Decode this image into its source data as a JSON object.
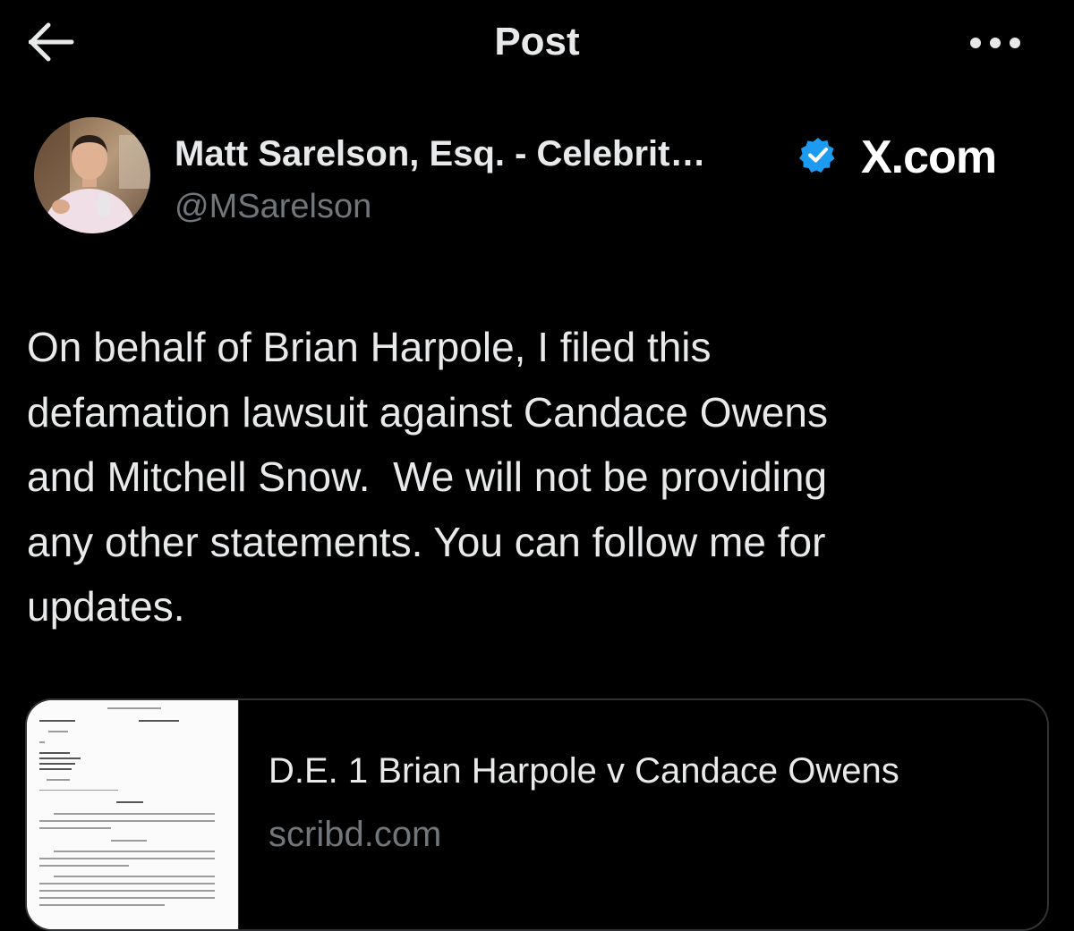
{
  "header": {
    "title": "Post",
    "back_icon": "arrow-left-icon",
    "more_icon": "more-horizontal-icon"
  },
  "post": {
    "author": {
      "name": "Matt Sarelson, Esq. - Celebrit…",
      "handle": "@MSarelson",
      "verified": true,
      "verified_color": "#1d9bf0"
    },
    "brand": "X.com",
    "text_lines": [
      "On behalf of Brian Harpole, I filed this",
      "defamation lawsuit against Candace Owens",
      "and Mitchell Snow.  We will not be providing",
      "any other statements. You can follow me for",
      "updates."
    ],
    "link_card": {
      "title": "D.E. 1 Brian Harpole v Candace Owens",
      "domain": "scribd.com"
    }
  },
  "colors": {
    "background": "#000000",
    "text": "#e7e9ea",
    "secondary": "#71767b",
    "border": "#2f3336"
  }
}
